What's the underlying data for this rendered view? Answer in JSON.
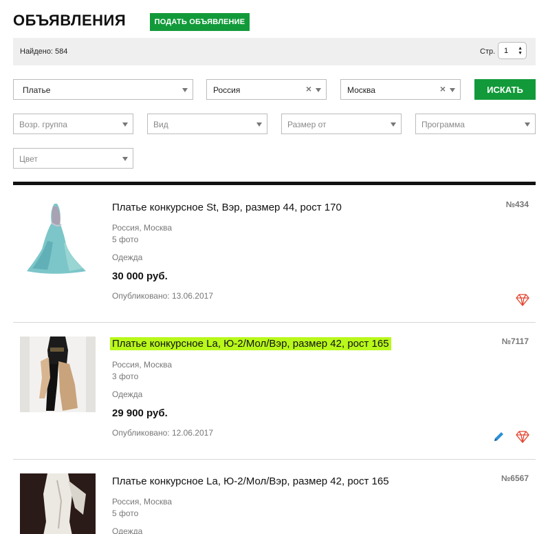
{
  "header": {
    "title": "ОБЪЯВЛЕНИЯ",
    "post_button": "ПОДАТЬ ОБЪЯВЛЕНИЕ"
  },
  "results_bar": {
    "found_text": "Найдено: 584",
    "page_label": "Стр.",
    "page_value": "1"
  },
  "filters": {
    "category": "Платье",
    "country": "Россия",
    "city": "Москва",
    "search_button": "ИСКАТЬ",
    "age_group_placeholder": "Возр. группа",
    "type_placeholder": "Вид",
    "size_placeholder": "Размер от",
    "program_placeholder": "Программа",
    "color_placeholder": "Цвет"
  },
  "colors": {
    "accent_green": "#129a3a",
    "highlight": "#b8f81a",
    "icon_red": "#e2442f",
    "icon_blue": "#2a8fd6"
  },
  "listings": [
    {
      "title": "Платье конкурсное St, Вэр, размер 44, рост 170",
      "location": "Россия, Москва",
      "photos": "5 фото",
      "category": "Одежда",
      "price": "30 000 руб.",
      "published": "Опубликовано: 13.06.2017",
      "number": "№434",
      "icons": [
        "gem-icon"
      ]
    },
    {
      "title": "Платье конкурсное La, Ю-2/Мол/Вэр, размер 42, рост 165",
      "location": "Россия, Москва",
      "photos": "3 фото",
      "category": "Одежда",
      "price": "29 900 руб.",
      "published": "Опубликовано: 12.06.2017",
      "number": "№7117",
      "icons": [
        "pencil-icon",
        "gem-icon"
      ]
    },
    {
      "title": "Платье конкурсное La, Ю-2/Мол/Вэр, размер 42, рост 165",
      "location": "Россия, Москва",
      "photos": "5 фото",
      "category": "Одежда",
      "number": "№6567"
    }
  ]
}
